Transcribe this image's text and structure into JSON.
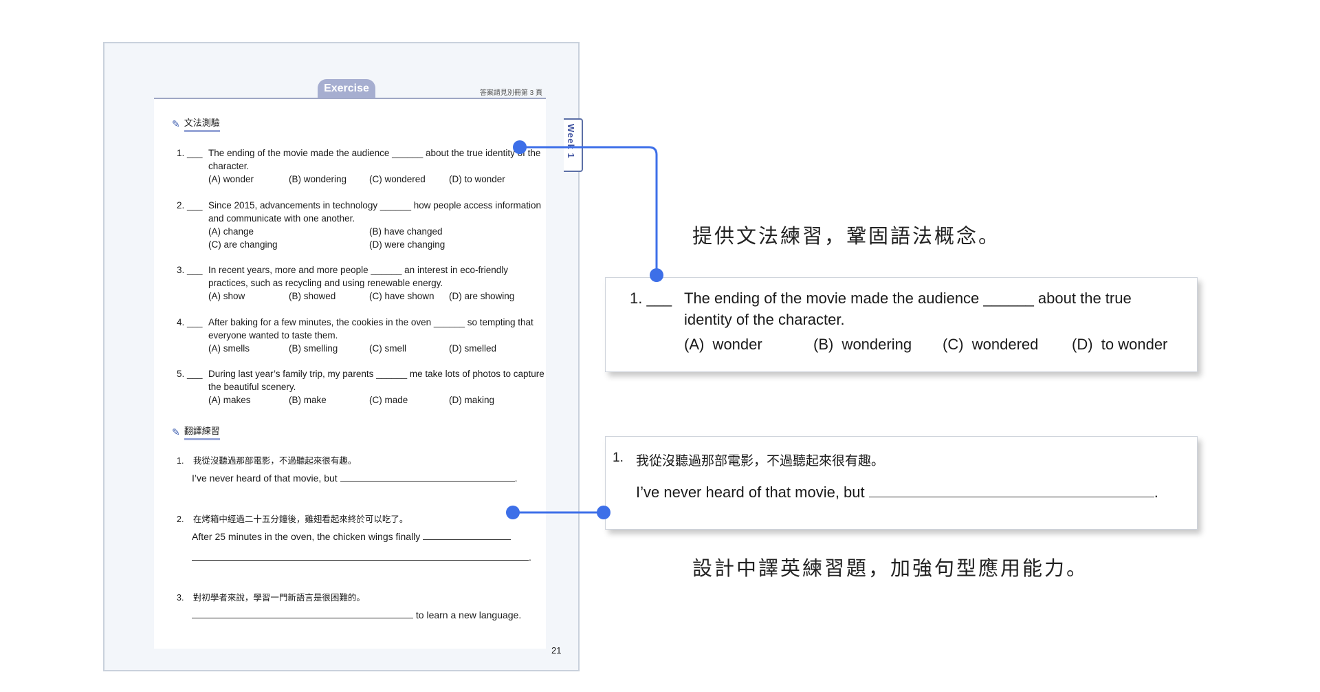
{
  "page": {
    "exercise_label": "Exercise",
    "answer_note": "答案請見別冊第 3 頁",
    "week_tab": "Week 1",
    "page_number": "21",
    "grammar_heading": "文法測驗",
    "translation_heading": "翻譯練習",
    "pencil_glyph": "✎",
    "grammar_questions": [
      {
        "num": "1. ___",
        "stem": "The ending of the movie made the audience ______ about the true identity of the character.",
        "options": [
          "(A)  wonder",
          "(B)  wondering",
          "(C)  wondered",
          "(D)  to wonder"
        ]
      },
      {
        "num": "2. ___",
        "stem": "Since 2015, advancements in technology ______ how people access information and communicate with one another.",
        "options": [
          "(A)  change",
          "(B)  have changed",
          "(C)  are changing",
          "(D)  were changing"
        ]
      },
      {
        "num": "3. ___",
        "stem": "In recent years, more and more people ______ an interest in eco-friendly practices, such as recycling and using renewable energy.",
        "options": [
          "(A)  show",
          "(B)  showed",
          "(C)  have shown",
          "(D)  are showing"
        ]
      },
      {
        "num": "4. ___",
        "stem": "After baking for a few minutes, the cookies in the oven ______ so tempting that everyone wanted to taste them.",
        "options": [
          "(A)  smells",
          "(B)  smelling",
          "(C)  smell",
          "(D)  smelled"
        ]
      },
      {
        "num": "5. ___",
        "stem": "During last year’s family trip, my parents ______ me take lots of photos to capture the beautiful scenery.",
        "options": [
          "(A)  makes",
          "(B)  make",
          "(C)  made",
          "(D)  making"
        ]
      }
    ],
    "translation_questions": [
      {
        "num": "1.",
        "zh": "我從沒聽過那部電影，不過聽起來很有趣。",
        "en": "I’ve never heard of that movie, but",
        "end": "."
      },
      {
        "num": "2.",
        "zh": "在烤箱中經過二十五分鐘後，雞翅看起來終於可以吃了。",
        "en": "After 25 minutes in the oven, the chicken wings finally",
        "end": "."
      },
      {
        "num": "3.",
        "zh": "對初學者來說，學習一門新語言是很困難的。",
        "en": "to learn a new language."
      }
    ]
  },
  "callouts": {
    "grammar_caption": "提供文法練習，鞏固語法概念。",
    "grammar_box": {
      "num": "1. ___",
      "stem_line1": "The ending of the movie made the audience ______ about the true",
      "stem_line2": "identity of the character.",
      "options": [
        "(A)  wonder",
        "(B)  wondering",
        "(C)  wondered",
        "(D)  to wonder"
      ]
    },
    "translation_box": {
      "num": "1.",
      "zh": "我從沒聽過那部電影，不過聽起來很有趣。",
      "en": "I’ve never heard of that movie, but",
      "end": "."
    },
    "translation_caption": "設計中譯英練習題，加強句型應用能力。"
  },
  "colors": {
    "connector": "#3d6fe8",
    "tab": "#a6aed0",
    "page_bg": "#f3f6fa"
  }
}
